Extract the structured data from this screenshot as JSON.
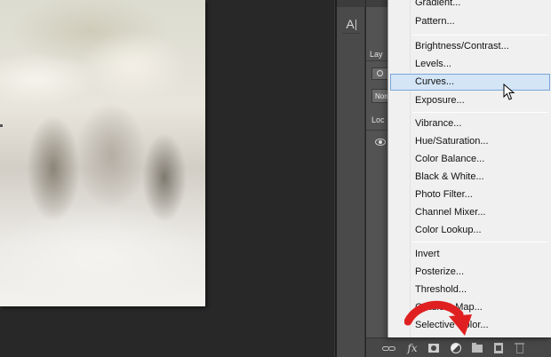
{
  "panels": {
    "layers_tab_label": "Lay",
    "blend_mode_label": "Normal",
    "lock_label": "Loc"
  },
  "character_panel": {
    "button_glyph": "A"
  },
  "bottom_toolbar": {
    "fx_label": "fx",
    "icons": [
      "link-layers-icon",
      "fx-icon",
      "layer-mask-icon",
      "adjustment-layer-icon",
      "group-folder-icon",
      "new-layer-icon",
      "trash-icon"
    ]
  },
  "adjustment_menu": {
    "items": [
      "Gradient...",
      "Pattern...",
      "Brightness/Contrast...",
      "Levels...",
      "Curves...",
      "Exposure...",
      "Vibrance...",
      "Hue/Saturation...",
      "Color Balance...",
      "Black & White...",
      "Photo Filter...",
      "Channel Mixer...",
      "Color Lookup...",
      "Invert",
      "Posterize...",
      "Threshold...",
      "Gradient Map...",
      "Selective Color..."
    ],
    "highlighted": "Curves..."
  },
  "colors": {
    "menu_highlight": "#d4e5f6",
    "menu_highlight_border": "#7aa6d6",
    "arrow_annotation": "#e02020",
    "panel_bg": "#535353",
    "workspace_bg": "#282828"
  }
}
